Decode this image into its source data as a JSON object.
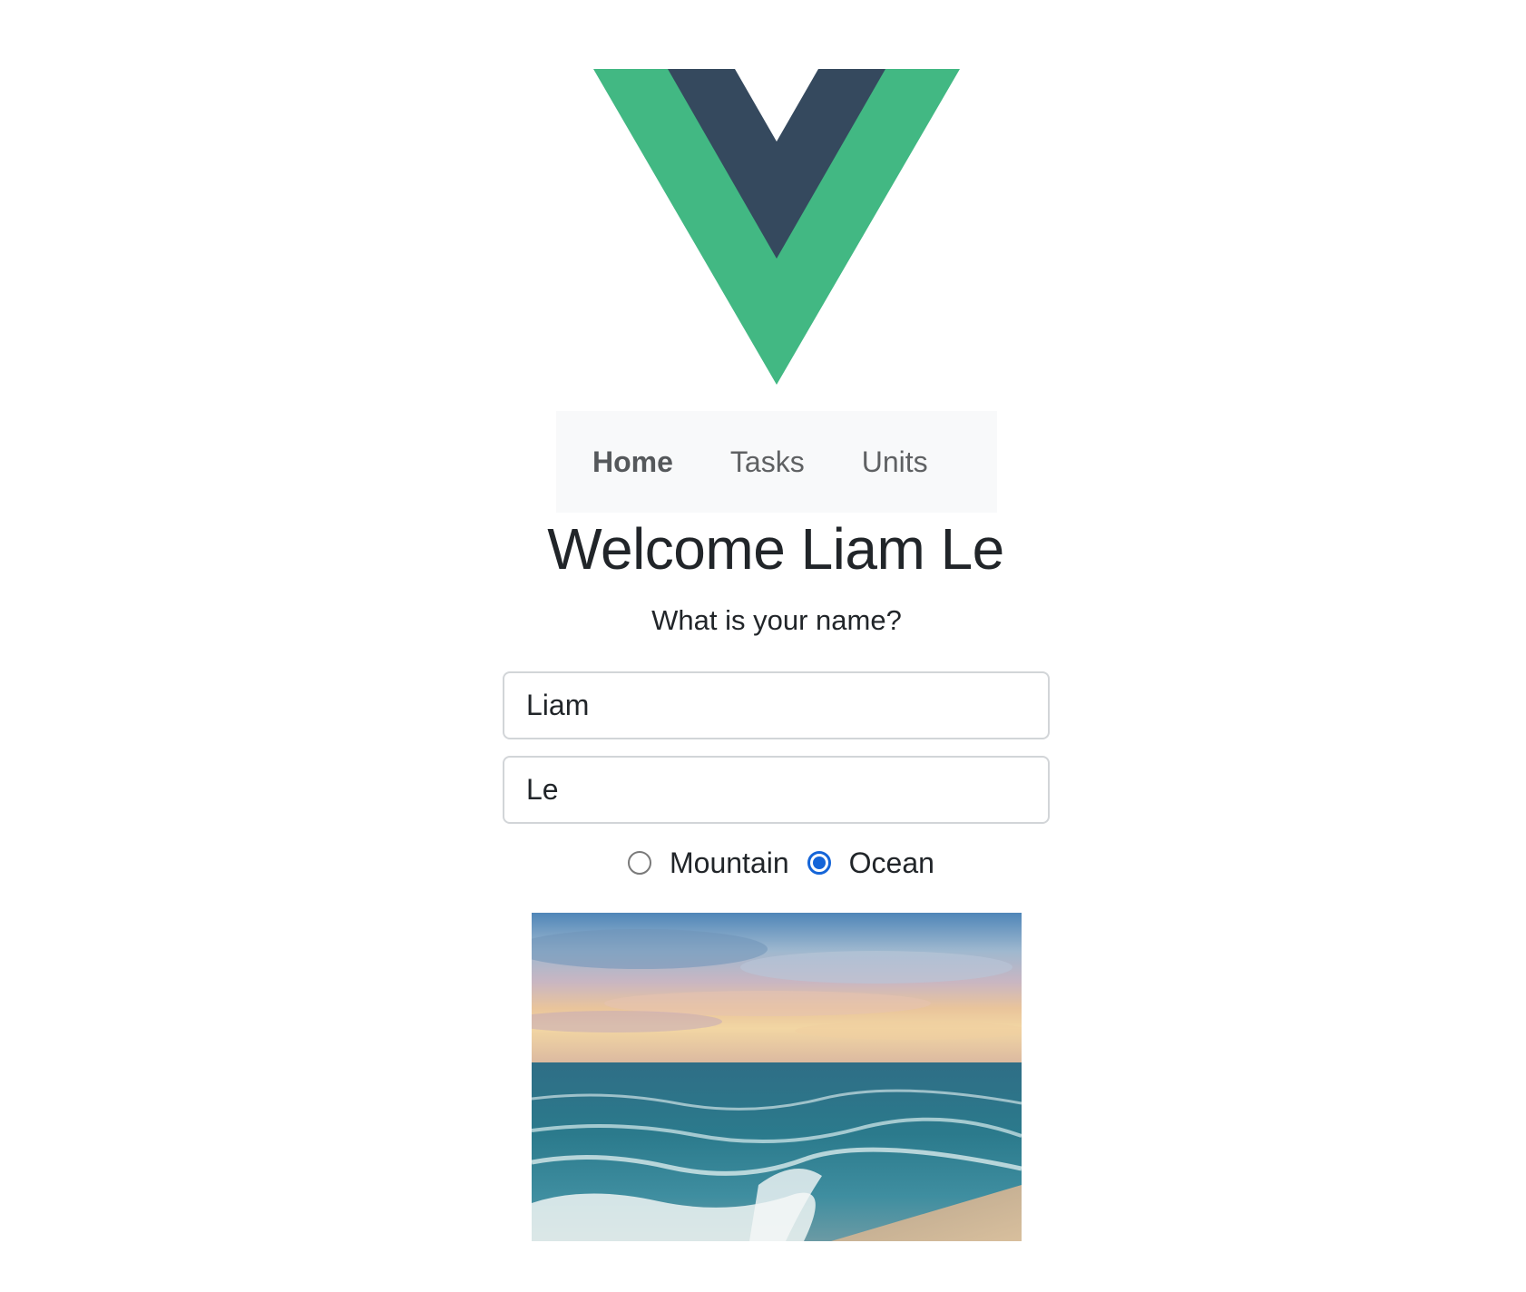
{
  "logo": {
    "name": "vue-logo",
    "colors": {
      "outer": "#42b883",
      "inner": "#35495e"
    }
  },
  "nav": {
    "items": [
      {
        "label": "Home",
        "active": true
      },
      {
        "label": "Tasks",
        "active": false
      },
      {
        "label": "Units",
        "active": false
      }
    ]
  },
  "welcome": {
    "title": "Welcome Liam Le",
    "prompt": "What is your name?"
  },
  "form": {
    "first_name": "Liam",
    "last_name": "Le",
    "scenery": {
      "options": [
        "Mountain",
        "Ocean"
      ],
      "selected": "Ocean"
    }
  },
  "image": {
    "subject": "ocean-sunset-photo"
  },
  "colors": {
    "nav_bg": "#f8f9fa",
    "radio_accent": "#1565d8",
    "text": "#212529"
  }
}
